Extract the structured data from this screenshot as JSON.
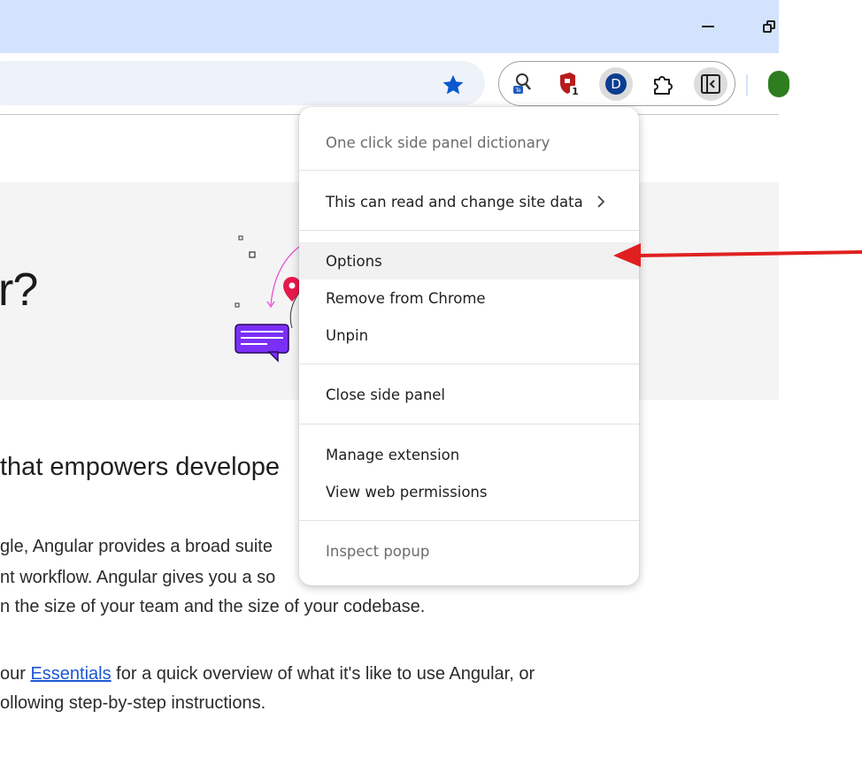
{
  "browser": {
    "minimize_icon": "minimize-icon",
    "restore_icon": "restore-icon",
    "bookmark_icon": "star-icon",
    "extensions": [
      {
        "name": "lookup-extension-icon"
      },
      {
        "name": "shield-extension-icon",
        "badge": "1"
      },
      {
        "name": "dictionary-extension-icon",
        "letter": "D"
      },
      {
        "name": "puzzle-icon"
      },
      {
        "name": "side-panel-icon"
      }
    ],
    "accent": "#d3e3fd"
  },
  "page": {
    "hero_title": "r?",
    "lead": "that empowers develope",
    "para1": {
      "line1": "gle, Angular provides a broad suite",
      "line2": "nt workflow. Angular gives you a so",
      "line3": "n the size of your team and the size of your codebase."
    },
    "para2": {
      "prefix": "our ",
      "link": "Essentials",
      "suffix": " for a quick overview of what it's like to use Angular, or",
      "line2": "ollowing step-by-step instructions."
    }
  },
  "menu": {
    "header": "One click side panel dictionary",
    "site_data": "This can read and change site data",
    "options": "Options",
    "remove": "Remove from Chrome",
    "unpin": "Unpin",
    "close_panel": "Close side panel",
    "manage": "Manage extension",
    "permissions": "View web permissions",
    "inspect": "Inspect popup"
  },
  "annotation": {
    "arrow_color": "#e02020"
  }
}
